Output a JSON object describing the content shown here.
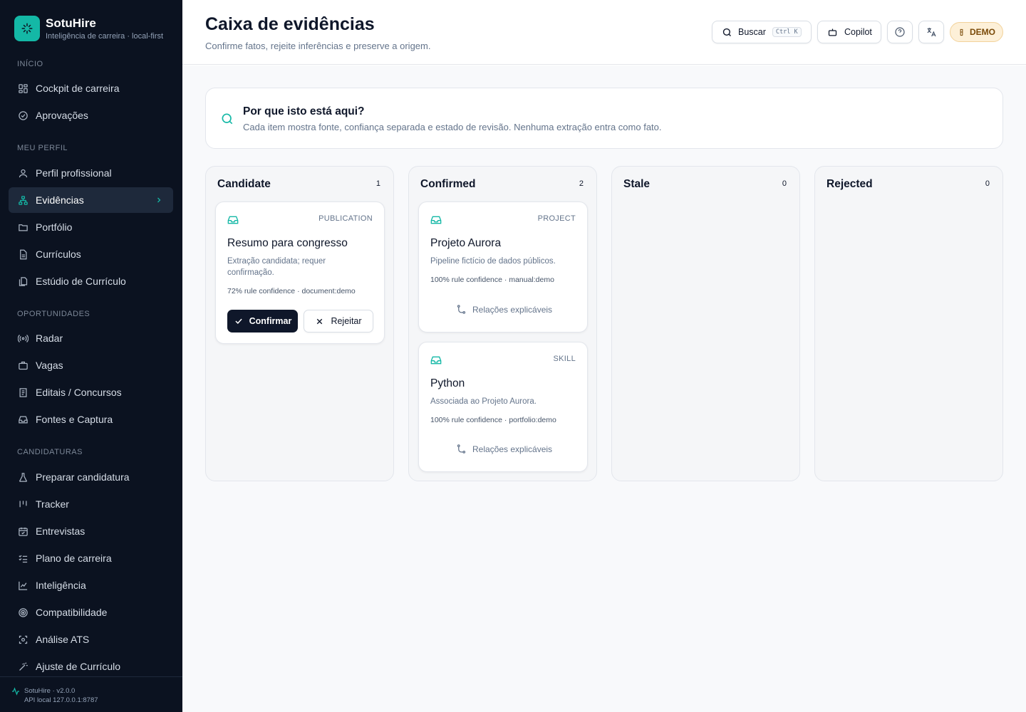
{
  "brand": {
    "name": "SotuHire",
    "tagline": "Inteligência de carreira · local-first"
  },
  "sidebar": {
    "sections": [
      {
        "title": "INÍCIO",
        "items": [
          {
            "label": "Cockpit de carreira",
            "icon": "dashboard-icon"
          },
          {
            "label": "Aprovações",
            "icon": "check-circle-icon"
          }
        ]
      },
      {
        "title": "MEU PERFIL",
        "items": [
          {
            "label": "Perfil profissional",
            "icon": "user-icon"
          },
          {
            "label": "Evidências",
            "icon": "network-icon",
            "active": true
          },
          {
            "label": "Portfólio",
            "icon": "folder-icon"
          },
          {
            "label": "Currículos",
            "icon": "file-icon"
          },
          {
            "label": "Estúdio de Currículo",
            "icon": "files-icon"
          }
        ]
      },
      {
        "title": "OPORTUNIDADES",
        "items": [
          {
            "label": "Radar",
            "icon": "radar-icon"
          },
          {
            "label": "Vagas",
            "icon": "briefcase-icon"
          },
          {
            "label": "Editais / Concursos",
            "icon": "document-list-icon"
          },
          {
            "label": "Fontes e Captura",
            "icon": "inbox-icon"
          }
        ]
      },
      {
        "title": "CANDIDATURAS",
        "items": [
          {
            "label": "Preparar candidatura",
            "icon": "flask-icon"
          },
          {
            "label": "Tracker",
            "icon": "kanban-icon"
          },
          {
            "label": "Entrevistas",
            "icon": "calendar-check-icon"
          },
          {
            "label": "Plano de carreira",
            "icon": "list-checks-icon"
          },
          {
            "label": "Inteligência",
            "icon": "line-chart-icon"
          },
          {
            "label": "Compatibilidade",
            "icon": "target-icon"
          },
          {
            "label": "Análise ATS",
            "icon": "scan-icon"
          },
          {
            "label": "Ajuste de Currículo",
            "icon": "wand-icon"
          }
        ]
      }
    ],
    "footer": {
      "version": "SotuHire · v2.0.0",
      "api": "API local 127.0.0.1:8787"
    }
  },
  "header": {
    "title": "Caixa de evidências",
    "subtitle": "Confirme fatos, rejeite inferências e preserve a origem.",
    "search_label": "Buscar",
    "search_shortcut": "Ctrl K",
    "copilot_label": "Copilot",
    "demo_label": "DEMO"
  },
  "info": {
    "title": "Por que isto está aqui?",
    "text": "Cada item mostra fonte, confiança separada e estado de revisão. Nenhuma extração entra como fato."
  },
  "columns": [
    {
      "title": "Candidate",
      "count": "1",
      "cards": [
        {
          "type": "PUBLICATION",
          "title": "Resumo para congresso",
          "description": "Extração candidata; requer confirmação.",
          "meta": "72% rule confidence · document:demo",
          "confirm_label": "Confirmar",
          "reject_label": "Rejeitar"
        }
      ]
    },
    {
      "title": "Confirmed",
      "count": "2",
      "cards": [
        {
          "type": "PROJECT",
          "title": "Projeto Aurora",
          "description": "Pipeline fictício de dados públicos.",
          "meta": "100% rule confidence · manual:demo",
          "relations_label": "Relações explicáveis"
        },
        {
          "type": "SKILL",
          "title": "Python",
          "description": "Associada ao Projeto Aurora.",
          "meta": "100% rule confidence · portfolio:demo",
          "relations_label": "Relações explicáveis"
        }
      ]
    },
    {
      "title": "Stale",
      "count": "0",
      "cards": []
    },
    {
      "title": "Rejected",
      "count": "0",
      "cards": []
    }
  ],
  "colors": {
    "accent": "#14b8a6",
    "sidebar_bg": "#0b1220",
    "primary_button": "#0f172a",
    "demo_bg": "#fdf0d8"
  }
}
